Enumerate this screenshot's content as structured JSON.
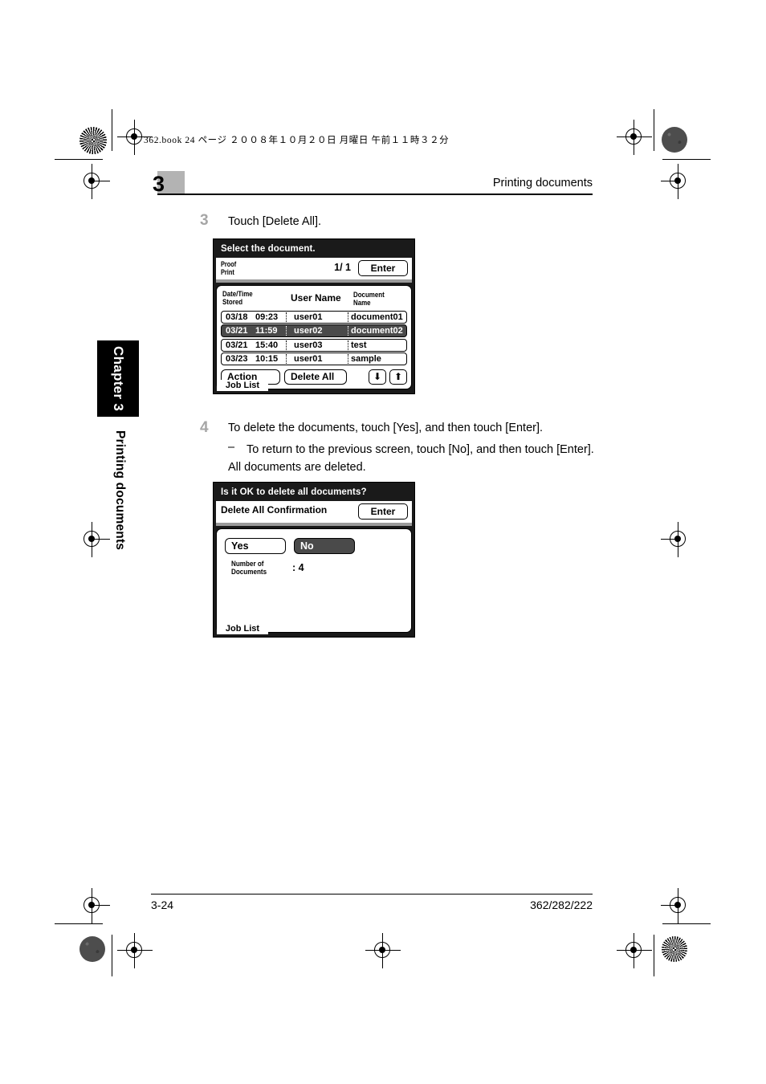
{
  "book_info": "362.book   24 ページ   ２００８年１０月２０日   月曜日   午前１１時３２分",
  "header": {
    "chapter_number": "3",
    "title": "Printing documents"
  },
  "side_tab": {
    "chapter_label": "Chapter 3",
    "section_label": "Printing documents"
  },
  "steps": [
    {
      "number": "3",
      "text": "Touch [Delete All]."
    },
    {
      "number": "4",
      "text": "To delete the documents, touch [Yes], and then touch [Enter].",
      "dash": "–",
      "sub_text": "To return to the previous screen, touch [No], and then touch [Enter].",
      "sub_text2": "All documents are deleted."
    }
  ],
  "panel1": {
    "title": "Select the document.",
    "mode_label_line1": "Proof",
    "mode_label_line2": "Print",
    "page_indicator": "1/ 1",
    "enter_label": "Enter",
    "columns": {
      "date_time_line1": "Date/Time",
      "date_time_line2": "Stored",
      "user_name": "User Name",
      "doc_name_line1": "Document",
      "doc_name_line2": "Name"
    },
    "rows": [
      {
        "date": "03/18",
        "time": "09:23",
        "user": "user01",
        "document": "document01",
        "selected": false
      },
      {
        "date": "03/21",
        "time": "11:59",
        "user": "user02",
        "document": "document02",
        "selected": true
      },
      {
        "date": "03/21",
        "time": "15:40",
        "user": "user03",
        "document": "test",
        "selected": false
      },
      {
        "date": "03/23",
        "time": "10:15",
        "user": "user01",
        "document": "sample",
        "selected": false
      }
    ],
    "action_label": "Action",
    "delete_all_label": "Delete All",
    "arrow_down": "⬇",
    "arrow_up": "⬆",
    "job_list_label": "Job List"
  },
  "panel2": {
    "title": "Is it OK to delete all documents?",
    "subtitle": "Delete All Confirmation",
    "enter_label": "Enter",
    "yes_label": "Yes",
    "no_label": "No",
    "number_of_docs_line1": "Number of",
    "number_of_docs_line2": "Documents",
    "number_of_docs_value": ": 4",
    "job_list_label": "Job List"
  },
  "footer": {
    "page": "3-24",
    "model": "362/282/222"
  },
  "colors": {
    "panel_bg": "#1a1a1a",
    "selected_row": "#4a4a4a",
    "chapter_box": "#b3b3b3",
    "step_number": "#a6a6a6"
  }
}
